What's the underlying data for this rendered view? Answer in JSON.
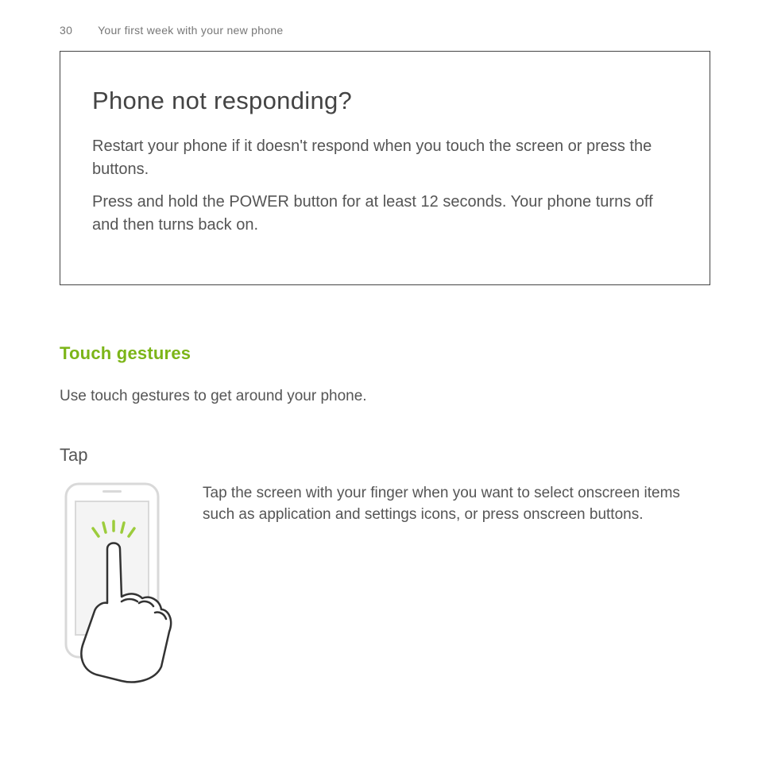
{
  "header": {
    "page_number": "30",
    "chapter": "Your first week with your new phone"
  },
  "callout": {
    "title": "Phone not responding?",
    "p1": "Restart your phone if it doesn't respond when you touch the screen or press the buttons.",
    "p2": "Press and hold the POWER button for at least 12 seconds. Your phone turns off and then turns back on."
  },
  "section": {
    "title": "Touch gestures",
    "intro": "Use touch gestures to get around your phone."
  },
  "gesture": {
    "name": "Tap",
    "description": "Tap the screen with your finger when you want to select onscreen items such as application and settings icons, or press onscreen buttons."
  },
  "colors": {
    "accent": "#7cb518",
    "text": "#555555",
    "border": "#444444"
  }
}
